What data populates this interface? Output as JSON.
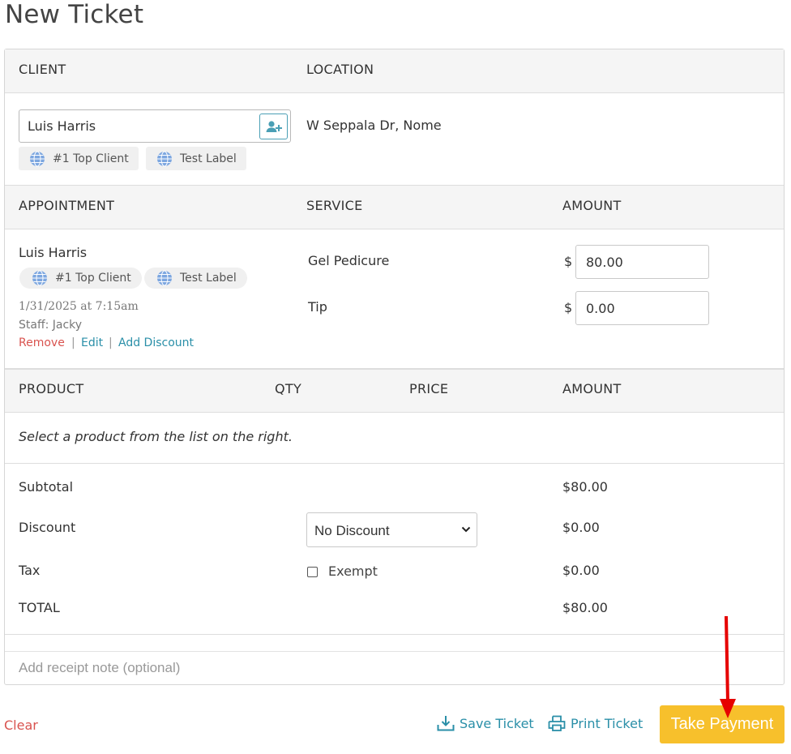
{
  "page": {
    "title": "New Ticket"
  },
  "client_section": {
    "client_header": "CLIENT",
    "location_header": "LOCATION",
    "client_name": "Luis Harris",
    "location": "W Seppala Dr, Nome",
    "tags": [
      "#1 Top Client",
      "Test Label"
    ],
    "add_client_icon": "add-user-icon"
  },
  "appointment_section": {
    "headers": {
      "appointment": "APPOINTMENT",
      "service": "SERVICE",
      "amount": "AMOUNT"
    },
    "client_name": "Luis Harris",
    "tags": [
      "#1 Top Client",
      "Test Label"
    ],
    "datetime": "1/31/2025 at 7:15am",
    "staff": "Staff: Jacky",
    "actions": {
      "remove": "Remove",
      "edit": "Edit",
      "add_discount": "Add Discount",
      "separator": "|"
    },
    "services": [
      {
        "name": "Gel Pedicure",
        "currency": "$",
        "amount": "80.00"
      },
      {
        "name": "Tip",
        "currency": "$",
        "amount": "0.00"
      }
    ]
  },
  "product_section": {
    "headers": {
      "product": "PRODUCT",
      "qty": "QTY",
      "price": "PRICE",
      "amount": "AMOUNT"
    },
    "empty_message": "Select a product from the list on the right."
  },
  "totals": {
    "subtotal_label": "Subtotal",
    "subtotal": "$80.00",
    "discount_label": "Discount",
    "discount_selected": "No Discount",
    "discount": "$0.00",
    "tax_label": "Tax",
    "tax_exempt_label": "Exempt",
    "tax_exempt_checked": false,
    "tax": "$0.00",
    "total_label": "TOTAL",
    "total": "$80.00"
  },
  "receipt_note": {
    "placeholder": "Add receipt note (optional)",
    "value": ""
  },
  "footer": {
    "clear": "Clear",
    "save_ticket": "Save Ticket",
    "print_ticket": "Print Ticket",
    "take_payment": "Take Payment"
  },
  "colors": {
    "accent_blue": "#2a8fa8",
    "danger_red": "#d9534f",
    "pay_button": "#f7c02c",
    "annotation_arrow": "#e60000"
  }
}
